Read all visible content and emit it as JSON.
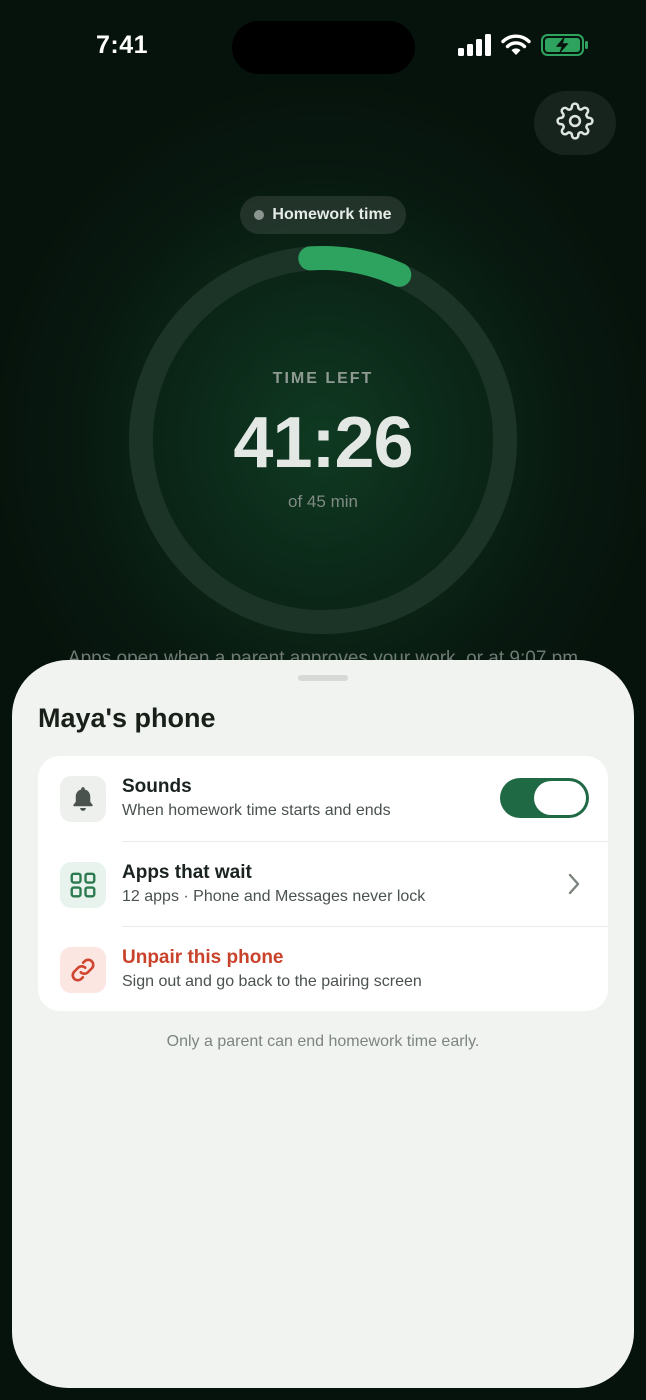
{
  "status_bar": {
    "time": "7:41",
    "icons": [
      "signal-icon",
      "wifi-icon",
      "battery-charging-icon"
    ]
  },
  "header": {
    "settings_icon": "gear-icon"
  },
  "session": {
    "mode_label": "Homework time",
    "time_left_label": "TIME LEFT",
    "time_remaining": "41:26",
    "total_label": "of 45 min",
    "elapsed_fraction": 0.08,
    "hint": "Apps open when a parent approves your work, or at 9:07 pm"
  },
  "sheet": {
    "title": "Maya's phone",
    "rows": [
      {
        "icon": "bell-icon",
        "title": "Sounds",
        "subtitle": "When homework time starts and ends",
        "control": "toggle",
        "toggle_on": true
      },
      {
        "icon": "apps-grid-icon",
        "title": "Apps that wait",
        "subtitle": "12 apps · Phone and Messages never lock",
        "control": "chevron-right-icon"
      },
      {
        "icon": "link-icon",
        "title": "Unpair this phone",
        "subtitle": "Sign out and go back to the pairing screen",
        "style": "destructive"
      }
    ],
    "footnote": "Only a parent can end homework time early."
  },
  "colors": {
    "accent": "#2ea35f",
    "toggle_on": "#1f6a44",
    "destructive": "#c9432c",
    "sheet_bg": "#f1f3f0",
    "screen_bg": "#081910"
  }
}
